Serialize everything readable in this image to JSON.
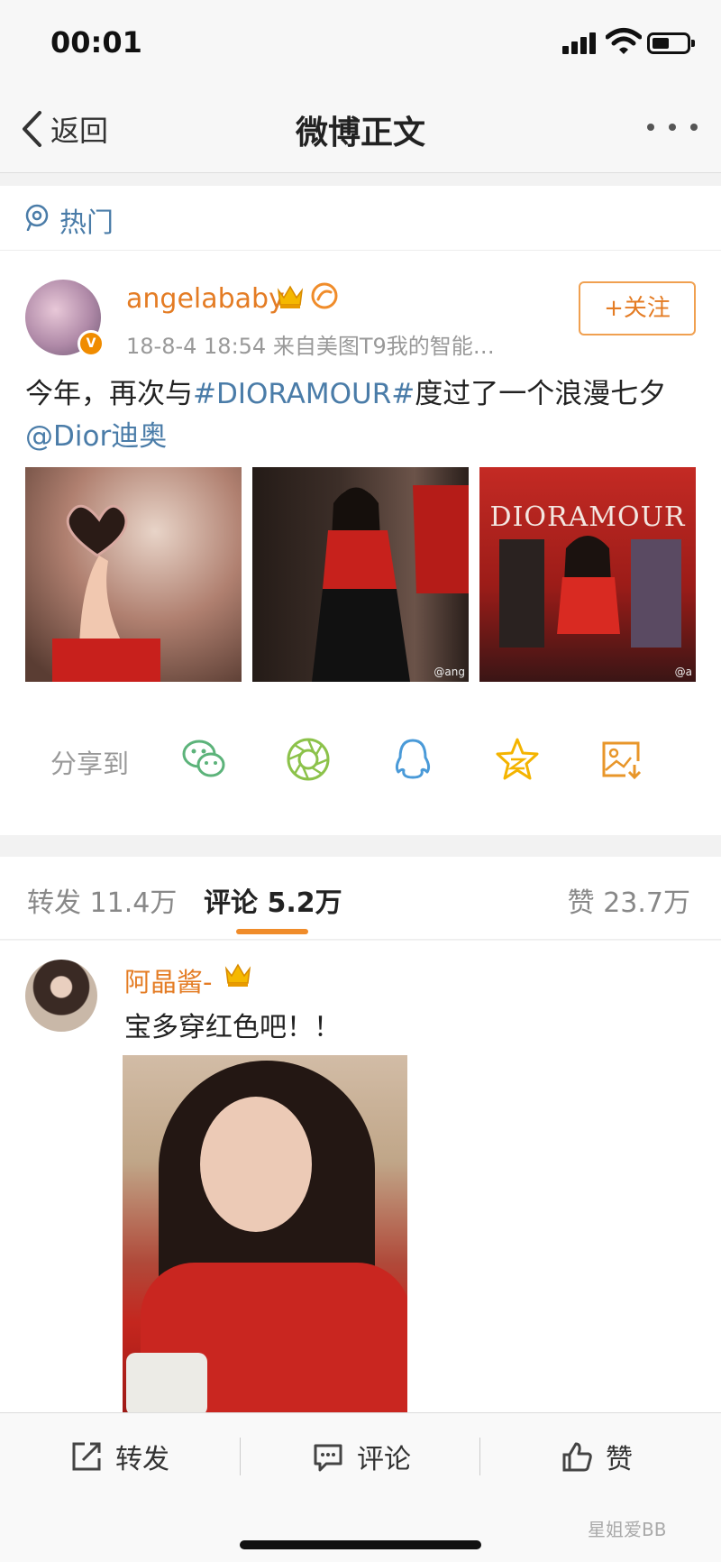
{
  "status_bar": {
    "time": "00:01"
  },
  "nav": {
    "back_label": "返回",
    "title": "微博正文"
  },
  "hot": {
    "label": "热门"
  },
  "post": {
    "user_name": "angelababy",
    "verified_badge": "V",
    "meta": "18-8-4 18:54  来自美图T9我的智能…",
    "follow_label": "+关注",
    "text_before": "今年，再次与",
    "hashtag": "#DIORAMOUR#",
    "text_after": "度过了一个浪漫七夕",
    "mention": "@Dior迪奥",
    "photos": [
      {
        "tag": ""
      },
      {
        "tag": "@ang"
      },
      {
        "tag": "@a",
        "caption": "DIORAMOUR"
      }
    ]
  },
  "share": {
    "label": "分享到",
    "targets": [
      "wechat-icon",
      "moments-icon",
      "qq-icon",
      "qzone-icon",
      "save-image-icon"
    ],
    "colors": {
      "wechat": "#5cb37a",
      "moments": "#8cc24a",
      "qq": "#4a9ad8",
      "qzone": "#f4b400",
      "save": "#e8962a"
    }
  },
  "tabs": {
    "repost": "转发 11.4万",
    "comment": "评论 5.2万",
    "like": "赞 23.7万",
    "active": "comment",
    "accent": "#f08c2a"
  },
  "comment": {
    "user_name": "阿晶酱-",
    "text": "宝多穿红色吧！！"
  },
  "toolbar": {
    "repost_label": "转发",
    "comment_label": "评论",
    "like_label": "赞"
  },
  "watermark": "星姐爱BB"
}
